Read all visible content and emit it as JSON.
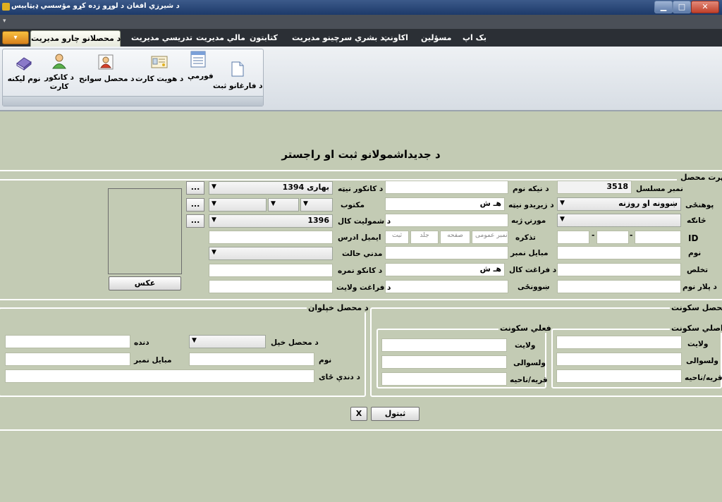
{
  "window": {
    "title": "د شيرزي افغان د لوړو زده کړو مؤسسي ډيټابيس",
    "controls": {
      "minimize": "▁",
      "maximize": "□",
      "close": "✕"
    }
  },
  "qat": {
    "arrow": "▾"
  },
  "menu": {
    "orb_label": "▾",
    "active": "د محصلانو چارو مديريت",
    "items": [
      "تدريسي مديريت",
      "مالي مديريت",
      "کتابتون",
      "د بشري سرچينو مديريت",
      "اکاونټ",
      "مسؤلين",
      "بک اپ"
    ]
  },
  "ribbon": {
    "buttons": [
      {
        "label": "د فارغانو ثبت",
        "icon": "document-icon"
      },
      {
        "label": "فورمې",
        "icon": "form-icon"
      },
      {
        "label": "د هويت کارت",
        "icon": "id-card-icon"
      },
      {
        "label": "د محصل سوانح",
        "icon": "student-profile-icon"
      },
      {
        "label": "د کانکور کارت",
        "icon": "user-card-icon"
      },
      {
        "label": "نوم ليکنه",
        "icon": "book-icon"
      }
    ]
  },
  "form": {
    "heading": "د جديداشمولانو ثبت او راجستر",
    "section_student": "شهرت محصل",
    "serial_label": "نمبر مسلسل",
    "serial_value": "3518",
    "faculty_label": "پوهنځی",
    "faculty_value": "ښوونه او روزنه",
    "department_label": "څانګه",
    "id_label": "ID",
    "name_label": "نوم",
    "takhallus_label": "تخلص",
    "father_label": "د پلار نوم",
    "grandfather_label": "د نيکه نوم",
    "birth_year_label": "د زيږيدو نيټه",
    "birth_year_value": "هـ ش",
    "mother_tongue_label": "مورنۍ ژبه",
    "tazkira_label": "تذکره",
    "tazkira_placeholders": [
      "نمبر عمومی",
      "صفحه",
      "جلد",
      "ثبت"
    ],
    "phone_label": "مبایل نمبر",
    "grad_year_label": "د فراغت کال",
    "grad_year_value": "هـ ش",
    "school_label": "ښوونځی",
    "kankor_date_label": "د کانکور نيټه",
    "kankor_date_value": "1394 بهاری",
    "letter_label": "مکتوب",
    "enroll_year_label": "د شموليت کال",
    "enroll_year_value": "1396",
    "email_label": "ايميل ادرس",
    "marital_label": "مدني حالت",
    "kankor_score_label": "د کانکو نمره",
    "grad_province_label": "د فراغت ولایت",
    "browse_label": "...",
    "photo_button": "عکس",
    "dash": "-"
  },
  "residence": {
    "section": "د محصل سکونت",
    "original": {
      "title": "اصلي سکونت",
      "labels": [
        "ولايت",
        "ولسوالی",
        "قريه/ناحيه"
      ]
    },
    "current": {
      "title": "فعلي سکونت",
      "labels": [
        "ولايت",
        "ولسوالی",
        "قريه/ناحيه"
      ]
    }
  },
  "relatives": {
    "section": "د محصل خپلوان",
    "relation_label": "د محصل خپل",
    "job_label": "دنده",
    "name_label": "نوم",
    "phone_label": "مبایل نمبر",
    "address_label": "د دندې ځای"
  },
  "actions": {
    "save": "ثبتول",
    "close": "X"
  }
}
